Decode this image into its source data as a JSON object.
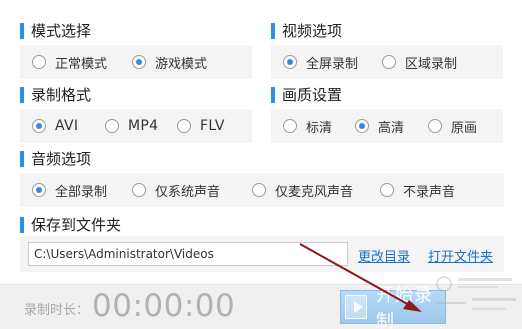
{
  "mode": {
    "title": "模式选择",
    "options": [
      "正常模式",
      "游戏模式"
    ],
    "selected": 1
  },
  "video": {
    "title": "视频选项",
    "options": [
      "全屏录制",
      "区域录制"
    ],
    "selected": 0
  },
  "format": {
    "title": "录制格式",
    "options": [
      "AVI",
      "MP4",
      "FLV"
    ],
    "selected": 0
  },
  "quality": {
    "title": "画质设置",
    "options": [
      "标清",
      "高清",
      "原画"
    ],
    "selected": 1
  },
  "audio": {
    "title": "音频选项",
    "options": [
      "全部录制",
      "仅系统声音",
      "仅麦克风声音",
      "不录声音"
    ],
    "selected": 0
  },
  "save": {
    "title": "保存到文件夹",
    "path": "C:\\Users\\Administrator\\Videos",
    "change_link": "更改目录",
    "open_link": "打开文件夹"
  },
  "footer": {
    "duration_label": "录制时长：",
    "duration_value": "00:00:00",
    "start_label": "开始录制"
  },
  "accent_color": "#2f8fe3",
  "annotation_arrow_color": "#8b1a1a"
}
